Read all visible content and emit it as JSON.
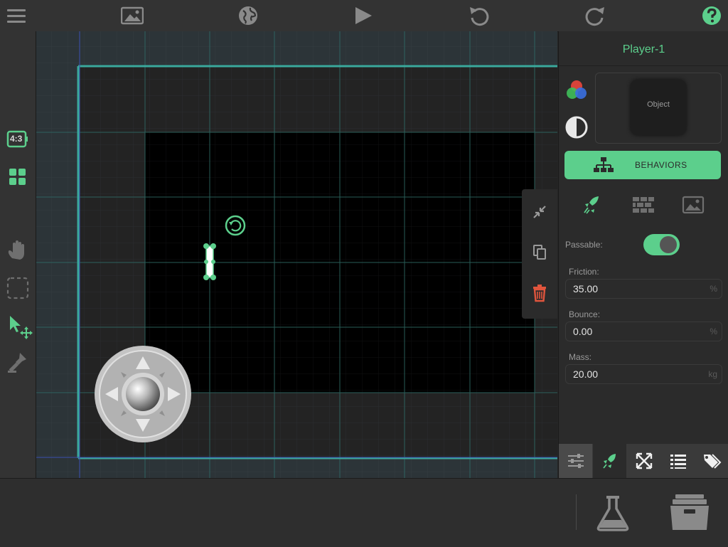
{
  "toolbar": {
    "icons": [
      "menu-icon",
      "image-icon",
      "globe-icon",
      "play-icon",
      "undo-icon",
      "redo-icon",
      "help-icon"
    ]
  },
  "left_tools": {
    "aspect_label": "4:3",
    "icons": [
      "aspect-ratio-icon",
      "grid-icon",
      "hand-icon",
      "select-box-icon",
      "pointer-move-icon",
      "stamp-icon"
    ]
  },
  "canvas": {
    "side_tools": [
      "collapse-icon",
      "copy-icon",
      "trash-icon"
    ],
    "joystick": "virtual-joystick"
  },
  "panel": {
    "title": "Player-1",
    "preview_label": "Object",
    "behaviors_label": "BEHAVIORS",
    "passable_label": "Passable:",
    "passable_on": true,
    "friction": {
      "label": "Friction:",
      "value": "35.00",
      "unit": "%"
    },
    "bounce": {
      "label": "Bounce:",
      "value": "0.00",
      "unit": "%"
    },
    "mass": {
      "label": "Mass:",
      "value": "20.00",
      "unit": "kg"
    }
  },
  "colors": {
    "accent": "#5ccf8c",
    "danger": "#e0553d",
    "toolbar_bg": "#333333"
  }
}
